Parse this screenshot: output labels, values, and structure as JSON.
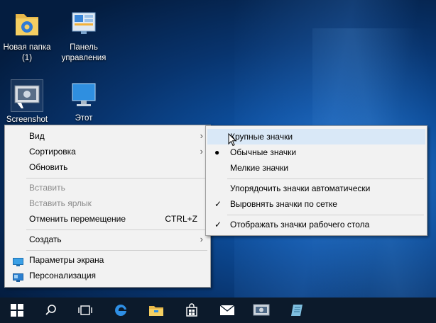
{
  "desktop": {
    "icons": [
      {
        "label": "Новая папка (1)"
      },
      {
        "label": "Панель управления"
      },
      {
        "label": "Screenshot"
      },
      {
        "label": "Этот"
      }
    ]
  },
  "context_menu": {
    "items": [
      {
        "label": "Вид",
        "has_submenu": true
      },
      {
        "label": "Сортировка",
        "has_submenu": true
      },
      {
        "label": "Обновить"
      },
      {
        "label": "Вставить",
        "disabled": true
      },
      {
        "label": "Вставить ярлык",
        "disabled": true
      },
      {
        "label": "Отменить перемещение",
        "shortcut": "CTRL+Z"
      },
      {
        "label": "Создать",
        "has_submenu": true
      },
      {
        "label": "Параметры экрана",
        "icon": "display-settings-icon"
      },
      {
        "label": "Персонализация",
        "icon": "personalization-icon"
      }
    ]
  },
  "view_submenu": {
    "items": [
      {
        "label": "Крупные значки",
        "hovered": true
      },
      {
        "label": "Обычные значки",
        "selected": true
      },
      {
        "label": "Мелкие значки"
      },
      {
        "label": "Упорядочить значки автоматически"
      },
      {
        "label": "Выровнять значки по сетке",
        "checked": true
      },
      {
        "label": "Отображать значки рабочего стола",
        "checked": true
      }
    ]
  },
  "taskbar": {
    "items": [
      "start-button",
      "search-button",
      "task-view-button",
      "edge-browser",
      "file-explorer",
      "store",
      "mail",
      "screenshot-app",
      "notes-app"
    ]
  },
  "colors": {
    "menu_bg": "#f2f2f2",
    "hover_bg": "#d9e8f7",
    "taskbar_bg": "#0c1a2b",
    "desktop_blue": "#0d4f9e"
  }
}
